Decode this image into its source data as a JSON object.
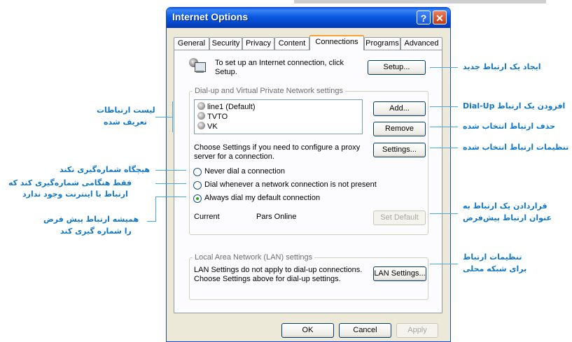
{
  "window": {
    "title": "Internet Options",
    "help_glyph": "?",
    "close_glyph": "✕"
  },
  "tabs": [
    "General",
    "Security",
    "Privacy",
    "Content",
    "Connections",
    "Programs",
    "Advanced"
  ],
  "active_tab": "Connections",
  "setup": {
    "text_line1": "To set up an Internet connection, click",
    "text_line2": "Setup.",
    "button": "Setup..."
  },
  "dialup": {
    "group_label": "Dial-up and Virtual Private Network settings",
    "connections": [
      "line1 (Default)",
      "TVTO",
      "VK"
    ],
    "add_button": "Add...",
    "remove_button": "Remove",
    "settings_text_line1": "Choose Settings if you need to configure a proxy",
    "settings_text_line2": "server for a connection.",
    "settings_button": "Settings...",
    "radio_options": [
      "Never dial a connection",
      "Dial whenever a network connection is not present",
      "Always dial my default connection"
    ],
    "selected_option": "Always dial my default connection",
    "current_label": "Current",
    "current_value": "Pars Online",
    "set_default_button": "Set Default"
  },
  "lan": {
    "group_label": "Local Area Network (LAN) settings",
    "text_line1": "LAN Settings do not apply to dial-up connections.",
    "text_line2": "Choose Settings above for dial-up settings.",
    "button": "LAN Settings..."
  },
  "footer": {
    "ok": "OK",
    "cancel": "Cancel",
    "apply": "Apply"
  },
  "annotations": {
    "setup_new": "ایجاد یک ارتباط جدید",
    "add_dialup": "افزودن یک ارتباط Dial-Up",
    "remove_selected": "حذف ارتباط انتخاب شده",
    "settings_selected": "تنظیمات ارتباط انتخاب شده",
    "list_line1": "لیست ارتباطات",
    "list_line2": "تعریف شده",
    "never_dial": "هیچگاه شماره‌گیری نکند",
    "dial_when_line1": "فقط هنگامی شماره‌گیری کند که",
    "dial_when_line2": "ارتباط با اینترنت وجود ندارد",
    "always_dial_line1": "همیشه ارتباط پیش فرض",
    "always_dial_line2": "را شماره گیری کند",
    "set_default_line1": "قراردادن یک ارتباط به",
    "set_default_line2": "عنوان ارتباط پیش‌فرض",
    "lan_line1": "تنظیمات ارتباط",
    "lan_line2": "برای شبکه محلی"
  },
  "colors": {
    "annotation": "#1177c8",
    "titlebar": "#0a59e0",
    "dialog_bg": "#ece9d8",
    "active_tab_accent": "#f2a33a"
  }
}
